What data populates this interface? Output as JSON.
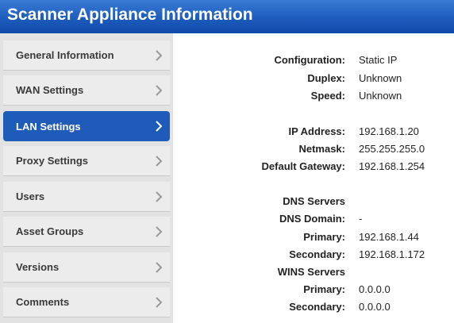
{
  "window": {
    "title": "Scanner Appliance Information"
  },
  "sidebar": {
    "items": [
      {
        "label": "General Information",
        "active": false
      },
      {
        "label": "WAN Settings",
        "active": false
      },
      {
        "label": "LAN Settings",
        "active": true
      },
      {
        "label": "Proxy Settings",
        "active": false
      },
      {
        "label": "Users",
        "active": false
      },
      {
        "label": "Asset Groups",
        "active": false
      },
      {
        "label": "Versions",
        "active": false
      },
      {
        "label": "Comments",
        "active": false
      }
    ]
  },
  "details": {
    "configuration": {
      "label": "Configuration:",
      "value": "Static IP"
    },
    "duplex": {
      "label": "Duplex:",
      "value": "Unknown"
    },
    "speed": {
      "label": "Speed:",
      "value": "Unknown"
    },
    "ip_address": {
      "label": "IP Address:",
      "value": "192.168.1.20"
    },
    "netmask": {
      "label": "Netmask:",
      "value": "255.255.255.0"
    },
    "default_gateway": {
      "label": "Default Gateway:",
      "value": "192.168.1.254"
    },
    "dns_servers_heading": "DNS Servers",
    "dns_domain": {
      "label": "DNS Domain:",
      "value": "-"
    },
    "dns_primary": {
      "label": "Primary:",
      "value": "192.168.1.44"
    },
    "dns_secondary": {
      "label": "Secondary:",
      "value": "192.168.1.172"
    },
    "wins_servers_heading": "WINS Servers",
    "wins_primary": {
      "label": "Primary:",
      "value": "0.0.0.0"
    },
    "wins_secondary": {
      "label": "Secondary:",
      "value": "0.0.0.0"
    }
  },
  "colors": {
    "titlebar": "#1f5fbf",
    "active_nav": "#1f5cb9",
    "sidebar_bg": "#e2e2e2"
  }
}
